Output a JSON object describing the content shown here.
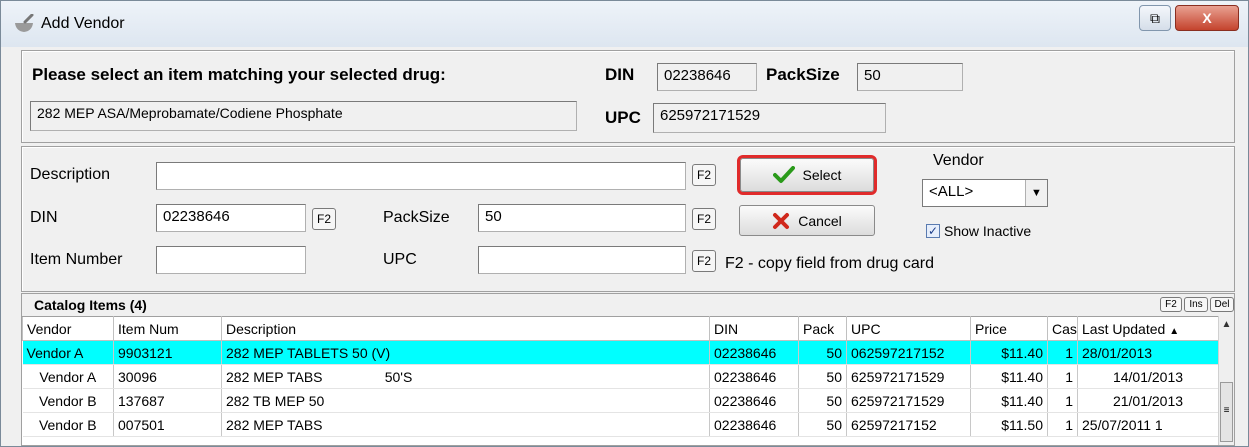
{
  "window": {
    "title": "Add Vendor",
    "restore_glyph": "⧉",
    "close_glyph": "X"
  },
  "header": {
    "prompt": "Please select an item matching your selected drug:",
    "drug_name": "282 MEP ASA/Meprobamate/Codiene Phosphate",
    "din_label": "DIN",
    "din_value": "02238646",
    "packsize_label": "PackSize",
    "packsize_value": "50",
    "upc_label": "UPC",
    "upc_value": "625972171529"
  },
  "search": {
    "description_label": "Description",
    "description_value": "",
    "din_label": "DIN",
    "din_value": "02238646",
    "packsize_label": "PackSize",
    "packsize_value": "50",
    "item_number_label": "Item Number",
    "item_number_value": "",
    "upc_label": "UPC",
    "upc_value": "",
    "f2_label": "F2",
    "hint": "F2 - copy field from drug card"
  },
  "actions": {
    "select_label": "Select",
    "cancel_label": "Cancel",
    "vendor_label": "Vendor",
    "vendor_selected": "<ALL>",
    "show_inactive_label": "Show Inactive",
    "show_inactive_checked": true
  },
  "catalog": {
    "title": "Catalog Items (4)",
    "mini_buttons": [
      "F2",
      "Ins",
      "Del"
    ],
    "columns": [
      "Vendor",
      "Item Num",
      "Description",
      "DIN",
      "Pack",
      "UPC",
      "Price",
      "Case",
      "Last Updated"
    ],
    "rows": [
      {
        "vendor": "Vendor A",
        "item_num": "9903121",
        "description": "282 MEP TABLETS 50 (V)",
        "din": "02238646",
        "pack": "50",
        "upc": "062597217152",
        "price": "$11.40",
        "case": "1",
        "last_updated": "28/01/2013",
        "selected": true
      },
      {
        "vendor": "Vendor A",
        "item_num": "30096",
        "description": "282 MEP TABS                50'S",
        "din": "02238646",
        "pack": "50",
        "upc": "625972171529",
        "price": "$11.40",
        "case": "1",
        "last_updated": "14/01/2013",
        "selected": false
      },
      {
        "vendor": "Vendor B",
        "item_num": "137687",
        "description": "282 TB MEP 50",
        "din": "02238646",
        "pack": "50",
        "upc": "625972171529",
        "price": "$11.40",
        "case": "1",
        "last_updated": "21/01/2013",
        "selected": false
      },
      {
        "vendor": "Vendor B",
        "item_num": "007501",
        "description": "282 MEP TABS",
        "din": "02238646",
        "pack": "50",
        "upc": "62597217152",
        "price": "$11.50",
        "case": "1",
        "last_updated": "25/07/2011 1",
        "selected": false
      }
    ]
  },
  "colors": {
    "selected_row": "#00ffff",
    "select_highlight": "#e02b2b",
    "checkmark": "#2a9a1a",
    "cancel_x": "#d0281c"
  }
}
